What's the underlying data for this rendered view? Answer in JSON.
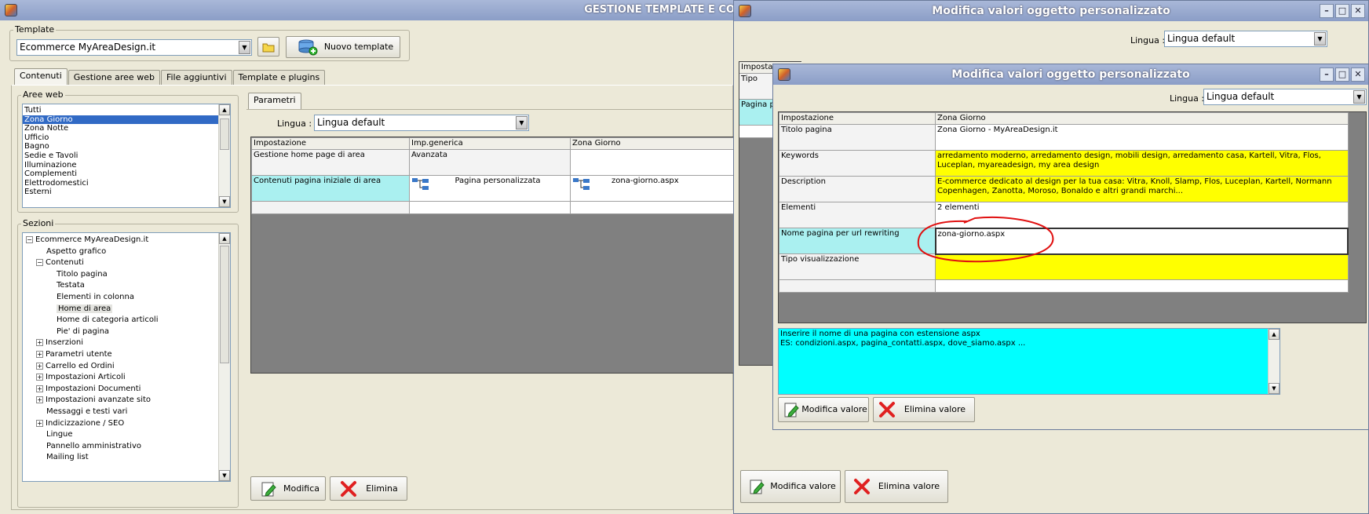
{
  "main_window": {
    "title": "GESTIONE TEMPLATE E CONTENUTI",
    "template_group_label": "Template",
    "template_value": "Ecommerce MyAreaDesign.it",
    "new_template_button": "Nuovo template",
    "tabs": [
      {
        "label": "Contenuti",
        "active": true
      },
      {
        "label": "Gestione aree web",
        "active": false
      },
      {
        "label": "File aggiuntivi",
        "active": false
      },
      {
        "label": "Template e plugins",
        "active": false
      }
    ],
    "aree_web_label": "Aree web",
    "aree_web": [
      "Tutti",
      "Zona Giorno",
      "Zona Notte",
      "Ufficio",
      "Bagno",
      "Sedie e Tavoli",
      "Illuminazione",
      "Complementi",
      "Elettrodomestici",
      "Esterni"
    ],
    "aree_web_selected": 1,
    "sezioni_label": "Sezioni",
    "tree": [
      {
        "label": "Ecommerce MyAreaDesign.it",
        "level": 0,
        "expander": "−"
      },
      {
        "label": "Aspetto grafico",
        "level": 1,
        "expander": ""
      },
      {
        "label": "Contenuti",
        "level": 1,
        "expander": "−"
      },
      {
        "label": "Titolo pagina",
        "level": 2,
        "expander": ""
      },
      {
        "label": "Testata",
        "level": 2,
        "expander": ""
      },
      {
        "label": "Elementi in colonna",
        "level": 2,
        "expander": ""
      },
      {
        "label": "Home di area",
        "level": 2,
        "expander": "",
        "selected": true
      },
      {
        "label": "Home di categoria articoli",
        "level": 2,
        "expander": ""
      },
      {
        "label": "Pie' di pagina",
        "level": 2,
        "expander": ""
      },
      {
        "label": "Inserzioni",
        "level": 1,
        "expander": "+"
      },
      {
        "label": "Parametri utente",
        "level": 1,
        "expander": "+"
      },
      {
        "label": "Carrello ed Ordini",
        "level": 1,
        "expander": "+"
      },
      {
        "label": "Impostazioni Articoli",
        "level": 1,
        "expander": "+"
      },
      {
        "label": "Impostazioni Documenti",
        "level": 1,
        "expander": "+"
      },
      {
        "label": "Impostazioni avanzate sito",
        "level": 1,
        "expander": "+"
      },
      {
        "label": "Messaggi e testi vari",
        "level": 1,
        "expander": ""
      },
      {
        "label": "Indicizzazione / SEO",
        "level": 1,
        "expander": "+"
      },
      {
        "label": "Lingue",
        "level": 1,
        "expander": ""
      },
      {
        "label": "Pannello amministrativo",
        "level": 1,
        "expander": ""
      },
      {
        "label": "Mailing list",
        "level": 1,
        "expander": ""
      }
    ],
    "params_tab": "Parametri",
    "lingua_label": "Lingua :",
    "lingua_value": "Lingua default",
    "grid_headers": [
      "Impostazione",
      "Imp.generica",
      "Zona Giorno"
    ],
    "grid_rows": [
      [
        "Gestione home page di area",
        "Avanzata",
        ""
      ],
      [
        "Contenuti pagina iniziale di area",
        "Pagina personalizzata",
        "zona-giorno.aspx"
      ]
    ],
    "modifica_button": "Modifica",
    "elimina_button": "Elimina"
  },
  "dialog_back": {
    "title": "Modifica valori oggetto personalizzato",
    "lingua_label": "Lingua :",
    "lingua_value": "Lingua default",
    "grid_header_partial": "Imposta",
    "row1_partial": "Tipo",
    "row2_partial": "Pagina p",
    "modifica_valore": "Modifica valore",
    "elimina_valore": "Elimina valore"
  },
  "dialog_front": {
    "title": "Modifica valori oggetto personalizzato",
    "lingua_label": "Lingua :",
    "lingua_value": "Lingua default",
    "grid_headers": [
      "Impostazione",
      "Zona Giorno"
    ],
    "grid_rows": [
      [
        "Titolo pagina",
        "Zona Giorno - MyAreaDesign.it"
      ],
      [
        "Keywords",
        "arredamento moderno, arredamento design, mobili design, arredamento casa, Kartell, Vitra, Flos, Luceplan, myareadesign, my area design"
      ],
      [
        "Description",
        "E-commerce dedicato al design per la tua casa: Vitra, Knoll, Slamp, Flos, Luceplan, Kartell, Normann Copenhagen, Zanotta, Moroso, Bonaldo e altri grandi marchi..."
      ],
      [
        "Elementi",
        "2 elementi"
      ],
      [
        "Nome pagina per url rewriting",
        "zona-giorno.aspx"
      ],
      [
        "Tipo visualizzazione",
        ""
      ]
    ],
    "hint_line1": "Inserire il nome di una pagina con estensione aspx",
    "hint_line2": "ES: condizioni.aspx, pagina_contatti.aspx, dove_siamo.aspx ...",
    "modifica_valore": "Modifica valore",
    "elimina_valore": "Elimina valore"
  },
  "colors": {
    "highlight_yellow": "#ffff00",
    "highlight_cyan": "#aaf0f0",
    "hint_cyan": "#00ffff",
    "annotation_red": "#e01010",
    "selection_blue": "#316ac5"
  }
}
